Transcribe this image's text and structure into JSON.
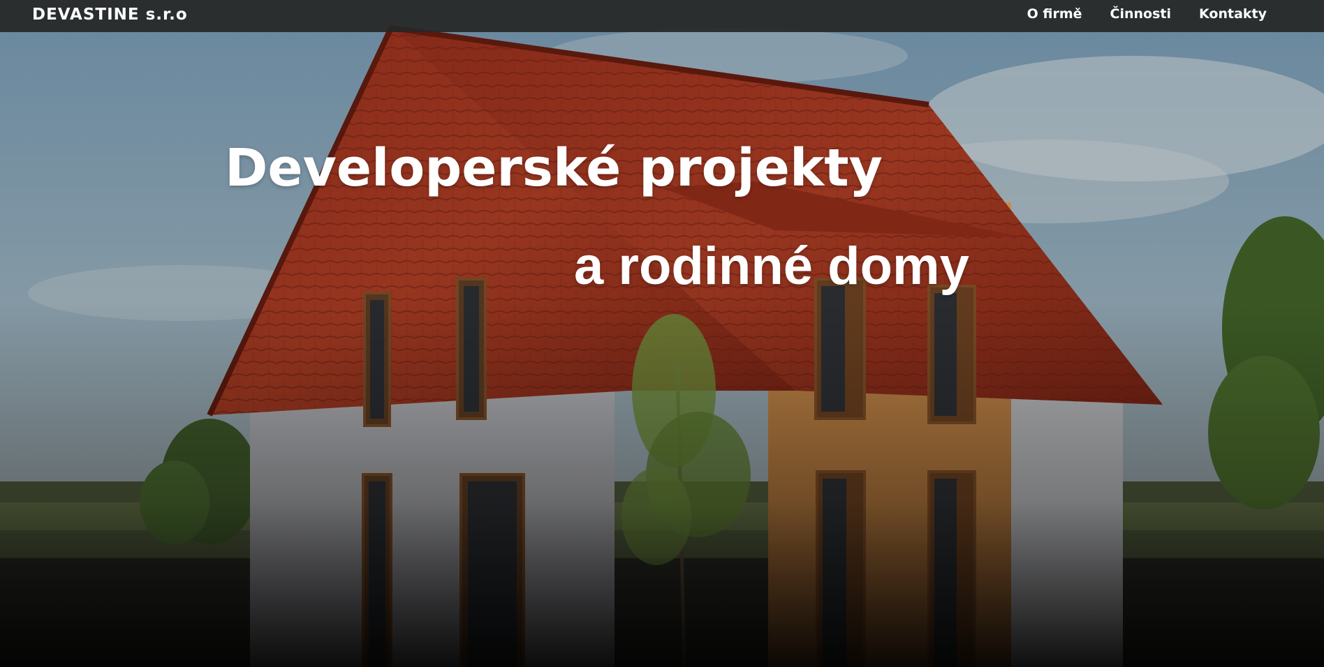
{
  "navbar": {
    "brand": "DEVASTINE s.r.o",
    "links": [
      {
        "label": "O firmě"
      },
      {
        "label": "Činnosti"
      },
      {
        "label": "Kontakty"
      }
    ]
  },
  "hero": {
    "headline_line1": "Developerské projekty",
    "headline_line2": "a rodinné domy",
    "image_subject": "two-storey family house with red tiled roof"
  },
  "colors": {
    "navbar_bg": "#262626",
    "text": "#ffffff",
    "roof": "#9c3320",
    "wall_left": "#d9d9dc",
    "wall_right": "#c98a45"
  }
}
